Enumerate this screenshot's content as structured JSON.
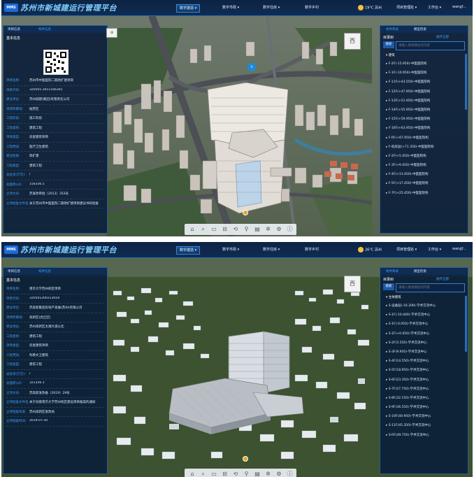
{
  "app": {
    "title": "苏州市新城建运行管理平台",
    "logo_text": "MMS",
    "nav_tabs": [
      "数字建造 ▾",
      "数字市政 ▾",
      "数字住房 ▾",
      "数字乡村"
    ],
    "weather": "19°C 苏州",
    "weather2": "26°C 苏州",
    "org": "项目管理处 ▾",
    "workspace": "工作台 ▾",
    "user": "wangf..."
  },
  "left_panel": {
    "tabs": [
      "项目信息",
      "构件信息"
    ],
    "section_title": "基本信息",
    "p1_fields": [
      {
        "k": "项目名称:",
        "v": "苏州市中医医院二期改扩建项目"
      },
      {
        "k": "项目代码:",
        "v": "320501-3011166301"
      },
      {
        "k": "建设单位:",
        "v": "苏州城建(集团)有限责任公司"
      },
      {
        "k": "项目所属地:",
        "v": "姑苏区"
      },
      {
        "k": "工程阶段:",
        "v": "施工阶段"
      },
      {
        "k": "工程类别:",
        "v": "建筑工程"
      },
      {
        "k": "项目类型:",
        "v": "房屋建筑项目"
      },
      {
        "k": "工程用途:",
        "v": "医疗卫生建筑"
      },
      {
        "k": "建设性质:",
        "v": "改扩建"
      },
      {
        "k": "工程类型:",
        "v": "建筑工程"
      },
      {
        "k": "总投资(万元):",
        "v": "/"
      },
      {
        "k": "总面积(㎡):",
        "v": "156336.5"
      },
      {
        "k": "立项文号:",
        "v": "苏发改审批〔2013〕353号"
      },
      {
        "k": "立项批复文件名称:",
        "v": "关于苏州市中医医院二期改扩建项目建议书的批复"
      }
    ],
    "p2_fields": [
      {
        "k": "项目名称:",
        "v": "南京大学苏州校区项目"
      },
      {
        "k": "项目代码:",
        "v": "320501200213018"
      },
      {
        "k": "建设单位:",
        "v": "苏高新集团房地产发展(苏州)有限公司"
      },
      {
        "k": "项目所属地:",
        "v": "高新区(虎丘区)"
      },
      {
        "k": "建设地址:",
        "v": "苏州高新区太湖大道以北"
      },
      {
        "k": "工程类别:",
        "v": "建筑工程"
      },
      {
        "k": "项目类型:",
        "v": "房屋建筑项目"
      },
      {
        "k": "工程用途:",
        "v": "科教文卫建筑"
      },
      {
        "k": "工程类型:",
        "v": "建筑工程"
      },
      {
        "k": "总投资(万元):",
        "v": "/"
      },
      {
        "k": "总面积(㎡):",
        "v": "321356.3"
      },
      {
        "k": "立项文号:",
        "v": "苏高新发改备〔2019〕29号"
      },
      {
        "k": "立项批复文件名称:",
        "v": "关于同意南京大学苏州校区建设项目备案的通知"
      },
      {
        "k": "立项批复机关:",
        "v": "苏州高新区发改局"
      },
      {
        "k": "立项批复时间:",
        "v": "2019-07-30"
      }
    ]
  },
  "right_panel": {
    "tabs": [
      "构件目录",
      "模型检索"
    ],
    "tree_label": "目录树",
    "search_label": "搜索",
    "search_placeholder": "请输入搜索楼层的内容",
    "action": "展开全部",
    "p1_category": "▾ 建筑",
    "p1_items": [
      "▸ F-2F(-15.950)-中医医院构",
      "▸ F-1F(-10.950)-中医医院构",
      "▸ F-11F(+43.550)-中医医院构",
      "▸ F-12F(+47.950)-中医医院构",
      "▸ F-13F(+51.950)-中医医院构",
      "▸ F-14F(+55.950)-中医医院构",
      "▸ F-15F(+59.950)-中医医院构",
      "▸ F-16F(+63.950)-中医医院构",
      "▸ F-RF(+67.950)-中医医院构",
      "▸ F-机房层(+71.350)-中医医院构",
      "▸ F-2F(+5.450)-中医医院构",
      "▸ F-3F(+9.450)-中医医院构",
      "▸ F-4F(+13.450)-中医医院构",
      "▸ F-5F(+17.450)-中医医院构",
      "▸ F-7F(+25.450)-中医医院构"
    ],
    "p2_category": "▾ 主体建筑",
    "p2_items": [
      "▸ S-设备层(-16.200)-学术交流中心",
      "▸ S-1F(-10.400)-学术交流中心",
      "▸ S-1F(-0.050)-学术交流中心",
      "▸ S-1F(+0.050)-学术交流中心",
      "▸ S-2F(5.550)-学术交流中心",
      "▸ S-3F(9.950)-学术交流中心",
      "▸ S-4F(14.550)-学术交流中心",
      "▸ S-5F(18.950)-学术交流中心",
      "▸ S-6F(23.350)-学术交流中心",
      "▸ S-7F(27.750)-学术交流中心",
      "▸ S-8F(32.150)-学术交流中心",
      "▸ S-9F(36.550)-学术交流中心",
      "▸ S-10F(40.950)-学术交流中心",
      "▸ S-11F(45.350)-学术交流中心",
      "▸ S-RF(49.750)-学术交流中心"
    ]
  },
  "map": {
    "compass_label": "西",
    "pin_label": "A",
    "tool_icons": [
      "⌂",
      "⌕",
      "▭",
      "⊟",
      "⟲",
      "⚲",
      "▤",
      "✲",
      "⚙",
      "ⓘ"
    ]
  },
  "colors": {
    "header": "#0e2b52",
    "panel": "#0a1e3a",
    "accent": "#3fa0ff",
    "title": "#7fd0ff"
  }
}
